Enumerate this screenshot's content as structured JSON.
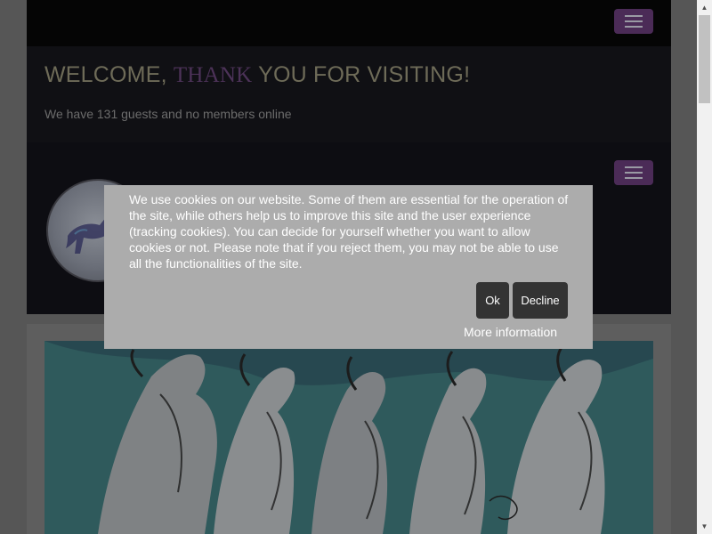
{
  "site": {
    "welcome": {
      "title_start": "WELCOME, ",
      "title_highlight": "THANK",
      "title_end": " YOU FOR VISITING!",
      "online_text": "We have 131 guests and no members online"
    },
    "nav_toggle_icon": "hamburger-icon",
    "logo_icon": "horse-icon"
  },
  "cookie_banner": {
    "text": "We use cookies on our website. Some of them are essential for the operation of the site, while others help us to improve this site and the user experience (tracking cookies). You can decide for yourself whether you want to allow cookies or not. Please note that if you reject them, you may not be able to use all the functionalities of the site.",
    "ok_label": "Ok",
    "decline_label": "Decline",
    "more_info_label": "More information"
  },
  "colors": {
    "accent": "#4b2b57",
    "cookie_background": "#acacac",
    "cookie_button": "#333333"
  }
}
